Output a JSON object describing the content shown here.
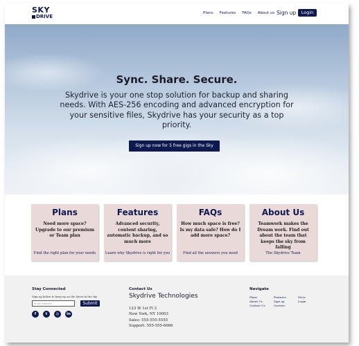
{
  "nav": {
    "logo_line1": "SKY",
    "logo_line2": "DRIVE",
    "links": [
      "Plans",
      "Features",
      "FAQs",
      "About us"
    ],
    "signup": "Sign up",
    "login": "Login"
  },
  "hero": {
    "title": "Sync. Share. Secure.",
    "text": "Skydrive is your one stop solution for backup and sharing needs. With AES-256 encoding and advanced encryption for your sensitive files, Skydrive has your security as a top priority.",
    "button": "Sign up now for 5 free gigs in the Sky"
  },
  "cards": [
    {
      "title": "Plans",
      "body": "Need more space? Upgrade to our premium or Team plan",
      "link": "Find the right plan for your needs"
    },
    {
      "title": "Features",
      "body": "Advanced security, content sharing, automatic backup, and so much more",
      "link": "Learn why Skydrive is right for you"
    },
    {
      "title": "FAQs",
      "body": "How much space is free? Is my data safe? How do I add more space?",
      "link": "Find all the answers you need"
    },
    {
      "title": "About Us",
      "body": "Teamwork makes the Dream work. Find out about the team that keeps the sky from falling",
      "link": "The Skydrive Team"
    }
  ],
  "footer": {
    "stay_title": "Stay Connected",
    "stay_text": "Sign up below to keep up on the latest in the sky",
    "email_placeholder": "Email Address",
    "submit": "Submit",
    "social_icons": [
      "facebook-icon",
      "twitter-icon",
      "instagram-icon",
      "linkedin-icon"
    ],
    "contact_title": "Contact Us",
    "company": "Skydrive Technologies",
    "address_lines": [
      "123 W 1st Fl 3",
      "New York, NY 10003",
      "Sales: 555-555-5555",
      "Support: 555-555-6666"
    ],
    "navigate_title": "Navigate",
    "nav_col1": [
      "Plans",
      "About Us",
      "Contact Us"
    ],
    "nav_col2": [
      "Features",
      "Sign up",
      "Careers"
    ],
    "nav_col3": [
      "FAQs",
      "Login"
    ]
  },
  "colors": {
    "brand": "#0e1a4f",
    "card_bg": "#ead9d9",
    "footer_bg": "#f1f1f1"
  }
}
